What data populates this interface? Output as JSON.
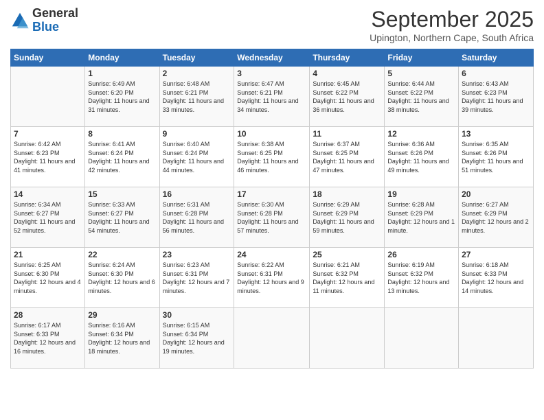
{
  "logo": {
    "general": "General",
    "blue": "Blue"
  },
  "header": {
    "month": "September 2025",
    "location": "Upington, Northern Cape, South Africa"
  },
  "weekdays": [
    "Sunday",
    "Monday",
    "Tuesday",
    "Wednesday",
    "Thursday",
    "Friday",
    "Saturday"
  ],
  "weeks": [
    [
      {
        "day": "",
        "sunrise": "",
        "sunset": "",
        "daylight": ""
      },
      {
        "day": "1",
        "sunrise": "Sunrise: 6:49 AM",
        "sunset": "Sunset: 6:20 PM",
        "daylight": "Daylight: 11 hours and 31 minutes."
      },
      {
        "day": "2",
        "sunrise": "Sunrise: 6:48 AM",
        "sunset": "Sunset: 6:21 PM",
        "daylight": "Daylight: 11 hours and 33 minutes."
      },
      {
        "day": "3",
        "sunrise": "Sunrise: 6:47 AM",
        "sunset": "Sunset: 6:21 PM",
        "daylight": "Daylight: 11 hours and 34 minutes."
      },
      {
        "day": "4",
        "sunrise": "Sunrise: 6:45 AM",
        "sunset": "Sunset: 6:22 PM",
        "daylight": "Daylight: 11 hours and 36 minutes."
      },
      {
        "day": "5",
        "sunrise": "Sunrise: 6:44 AM",
        "sunset": "Sunset: 6:22 PM",
        "daylight": "Daylight: 11 hours and 38 minutes."
      },
      {
        "day": "6",
        "sunrise": "Sunrise: 6:43 AM",
        "sunset": "Sunset: 6:23 PM",
        "daylight": "Daylight: 11 hours and 39 minutes."
      }
    ],
    [
      {
        "day": "7",
        "sunrise": "Sunrise: 6:42 AM",
        "sunset": "Sunset: 6:23 PM",
        "daylight": "Daylight: 11 hours and 41 minutes."
      },
      {
        "day": "8",
        "sunrise": "Sunrise: 6:41 AM",
        "sunset": "Sunset: 6:24 PM",
        "daylight": "Daylight: 11 hours and 42 minutes."
      },
      {
        "day": "9",
        "sunrise": "Sunrise: 6:40 AM",
        "sunset": "Sunset: 6:24 PM",
        "daylight": "Daylight: 11 hours and 44 minutes."
      },
      {
        "day": "10",
        "sunrise": "Sunrise: 6:38 AM",
        "sunset": "Sunset: 6:25 PM",
        "daylight": "Daylight: 11 hours and 46 minutes."
      },
      {
        "day": "11",
        "sunrise": "Sunrise: 6:37 AM",
        "sunset": "Sunset: 6:25 PM",
        "daylight": "Daylight: 11 hours and 47 minutes."
      },
      {
        "day": "12",
        "sunrise": "Sunrise: 6:36 AM",
        "sunset": "Sunset: 6:26 PM",
        "daylight": "Daylight: 11 hours and 49 minutes."
      },
      {
        "day": "13",
        "sunrise": "Sunrise: 6:35 AM",
        "sunset": "Sunset: 6:26 PM",
        "daylight": "Daylight: 11 hours and 51 minutes."
      }
    ],
    [
      {
        "day": "14",
        "sunrise": "Sunrise: 6:34 AM",
        "sunset": "Sunset: 6:27 PM",
        "daylight": "Daylight: 11 hours and 52 minutes."
      },
      {
        "day": "15",
        "sunrise": "Sunrise: 6:33 AM",
        "sunset": "Sunset: 6:27 PM",
        "daylight": "Daylight: 11 hours and 54 minutes."
      },
      {
        "day": "16",
        "sunrise": "Sunrise: 6:31 AM",
        "sunset": "Sunset: 6:28 PM",
        "daylight": "Daylight: 11 hours and 56 minutes."
      },
      {
        "day": "17",
        "sunrise": "Sunrise: 6:30 AM",
        "sunset": "Sunset: 6:28 PM",
        "daylight": "Daylight: 11 hours and 57 minutes."
      },
      {
        "day": "18",
        "sunrise": "Sunrise: 6:29 AM",
        "sunset": "Sunset: 6:29 PM",
        "daylight": "Daylight: 11 hours and 59 minutes."
      },
      {
        "day": "19",
        "sunrise": "Sunrise: 6:28 AM",
        "sunset": "Sunset: 6:29 PM",
        "daylight": "Daylight: 12 hours and 1 minute."
      },
      {
        "day": "20",
        "sunrise": "Sunrise: 6:27 AM",
        "sunset": "Sunset: 6:29 PM",
        "daylight": "Daylight: 12 hours and 2 minutes."
      }
    ],
    [
      {
        "day": "21",
        "sunrise": "Sunrise: 6:25 AM",
        "sunset": "Sunset: 6:30 PM",
        "daylight": "Daylight: 12 hours and 4 minutes."
      },
      {
        "day": "22",
        "sunrise": "Sunrise: 6:24 AM",
        "sunset": "Sunset: 6:30 PM",
        "daylight": "Daylight: 12 hours and 6 minutes."
      },
      {
        "day": "23",
        "sunrise": "Sunrise: 6:23 AM",
        "sunset": "Sunset: 6:31 PM",
        "daylight": "Daylight: 12 hours and 7 minutes."
      },
      {
        "day": "24",
        "sunrise": "Sunrise: 6:22 AM",
        "sunset": "Sunset: 6:31 PM",
        "daylight": "Daylight: 12 hours and 9 minutes."
      },
      {
        "day": "25",
        "sunrise": "Sunrise: 6:21 AM",
        "sunset": "Sunset: 6:32 PM",
        "daylight": "Daylight: 12 hours and 11 minutes."
      },
      {
        "day": "26",
        "sunrise": "Sunrise: 6:19 AM",
        "sunset": "Sunset: 6:32 PM",
        "daylight": "Daylight: 12 hours and 13 minutes."
      },
      {
        "day": "27",
        "sunrise": "Sunrise: 6:18 AM",
        "sunset": "Sunset: 6:33 PM",
        "daylight": "Daylight: 12 hours and 14 minutes."
      }
    ],
    [
      {
        "day": "28",
        "sunrise": "Sunrise: 6:17 AM",
        "sunset": "Sunset: 6:33 PM",
        "daylight": "Daylight: 12 hours and 16 minutes."
      },
      {
        "day": "29",
        "sunrise": "Sunrise: 6:16 AM",
        "sunset": "Sunset: 6:34 PM",
        "daylight": "Daylight: 12 hours and 18 minutes."
      },
      {
        "day": "30",
        "sunrise": "Sunrise: 6:15 AM",
        "sunset": "Sunset: 6:34 PM",
        "daylight": "Daylight: 12 hours and 19 minutes."
      },
      {
        "day": "",
        "sunrise": "",
        "sunset": "",
        "daylight": ""
      },
      {
        "day": "",
        "sunrise": "",
        "sunset": "",
        "daylight": ""
      },
      {
        "day": "",
        "sunrise": "",
        "sunset": "",
        "daylight": ""
      },
      {
        "day": "",
        "sunrise": "",
        "sunset": "",
        "daylight": ""
      }
    ]
  ]
}
